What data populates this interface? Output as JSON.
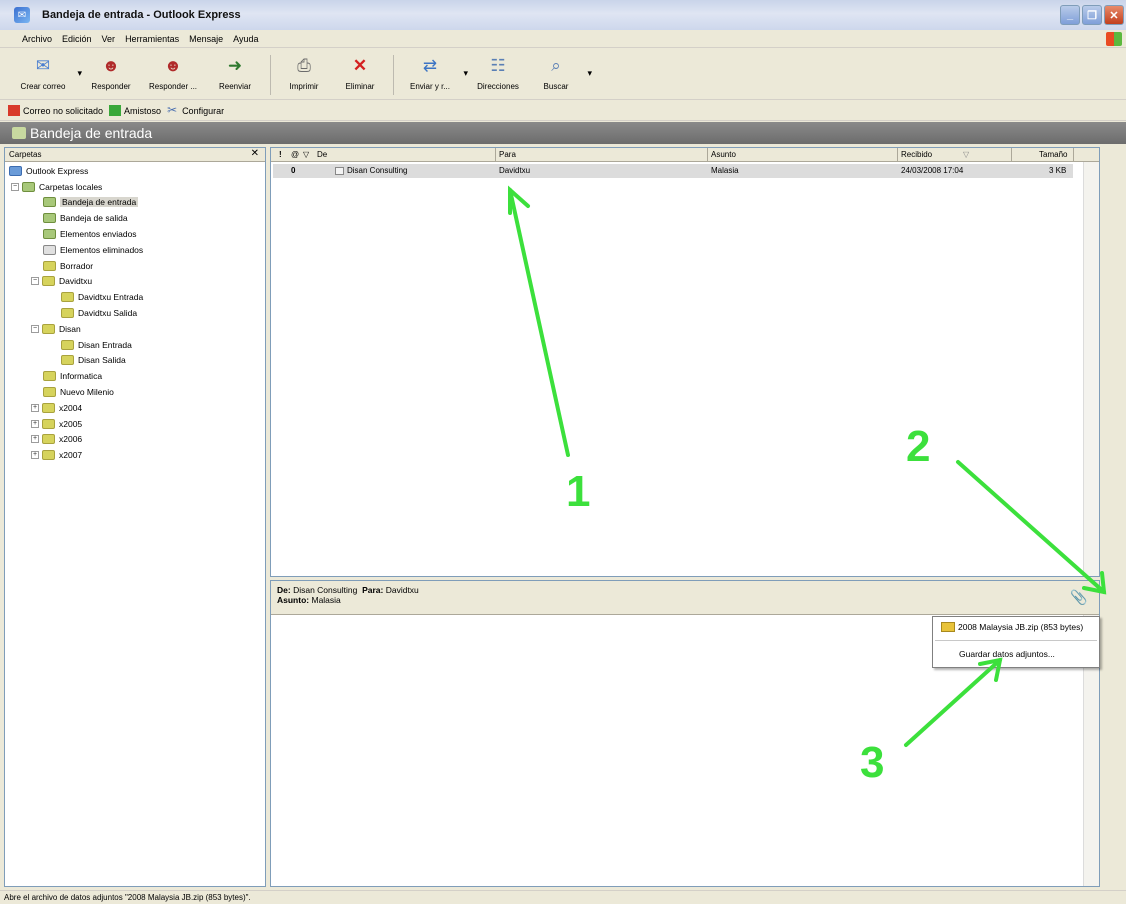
{
  "window": {
    "title": "Bandeja de entrada - Outlook Express"
  },
  "menu": [
    "Archivo",
    "Edición",
    "Ver",
    "Herramientas",
    "Mensaje",
    "Ayuda"
  ],
  "toolbar": {
    "create": "Crear correo",
    "reply": "Responder",
    "reply_all": "Responder ...",
    "forward": "Reenviar",
    "print": "Imprimir",
    "delete": "Eliminar",
    "send_receive": "Enviar y r...",
    "addresses": "Direcciones",
    "find": "Buscar"
  },
  "toolbar2": {
    "junk": "Correo no solicitado",
    "friendly": "Amistoso",
    "configure": "Configurar"
  },
  "folder_bar": {
    "title": "Bandeja de entrada"
  },
  "folders": {
    "header": "Carpetas",
    "items": [
      "Outlook Express",
      "Carpetas locales",
      "Bandeja de entrada",
      "Bandeja de salida",
      "Elementos enviados",
      "Elementos eliminados",
      "Borrador",
      "Davidtxu",
      "Davidtxu Entrada",
      "Davidtxu Salida",
      "Disan",
      "Disan Entrada",
      "Disan Salida",
      "Informatica",
      "Nuevo Milenio",
      "x2004",
      "x2005",
      "x2006",
      "x2007"
    ]
  },
  "message_list": {
    "columns": {
      "flag": "!",
      "attach": "@",
      "watch": "▽",
      "from": "De",
      "to": "Para",
      "subject": "Asunto",
      "received": "Recibido",
      "size": "Tamaño"
    },
    "rows": [
      {
        "from": "Disan Consulting",
        "to": "Davidtxu",
        "subject": "Malasia",
        "received": "24/03/2008 17:04",
        "size": "3 KB"
      }
    ]
  },
  "preview": {
    "from_label": "De:",
    "from": "Disan Consulting",
    "to_label": "Para:",
    "to": "Davidtxu",
    "subject_label": "Asunto:",
    "subject": "Malasia"
  },
  "attachment_menu": {
    "file": "2008 Malaysia JB.zip (853 bytes)",
    "save": "Guardar datos adjuntos..."
  },
  "status": {
    "text": "Abre el archivo de datos adjuntos \"2008 Malaysia JB.zip (853 bytes)\"."
  },
  "annotations": {
    "one": "1",
    "two": "2",
    "three": "3",
    "color": "#3ce03c"
  }
}
